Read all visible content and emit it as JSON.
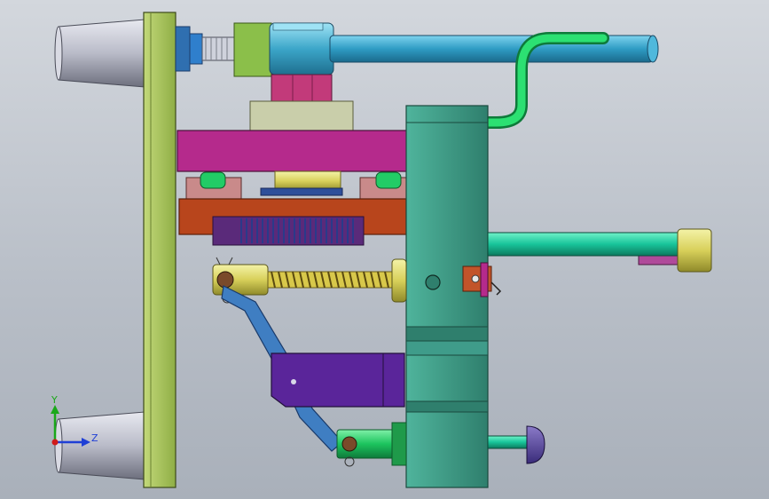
{
  "axes": {
    "y_label": "Y",
    "z_label": "Z",
    "y_color": "#1aa81a",
    "z_color": "#1f3fd6",
    "x_color": "#d01a1a"
  },
  "colors": {
    "background_top": "#d3d7dd",
    "background_bottom": "#a9b0ba",
    "cone": "#c8cad4",
    "backplate": "#a7c05a",
    "ejector_block": "#3f9c8a",
    "cooling_tube_blue": "#3aa8cc",
    "cooling_tube_green": "#22cc66",
    "gear_plate": "#b52a6a",
    "rack": "#b8451c",
    "spring": "#c8b43c",
    "link_arm": "#3f7ec2",
    "slider_block": "#5a259a",
    "nut": "#c23a7a"
  }
}
